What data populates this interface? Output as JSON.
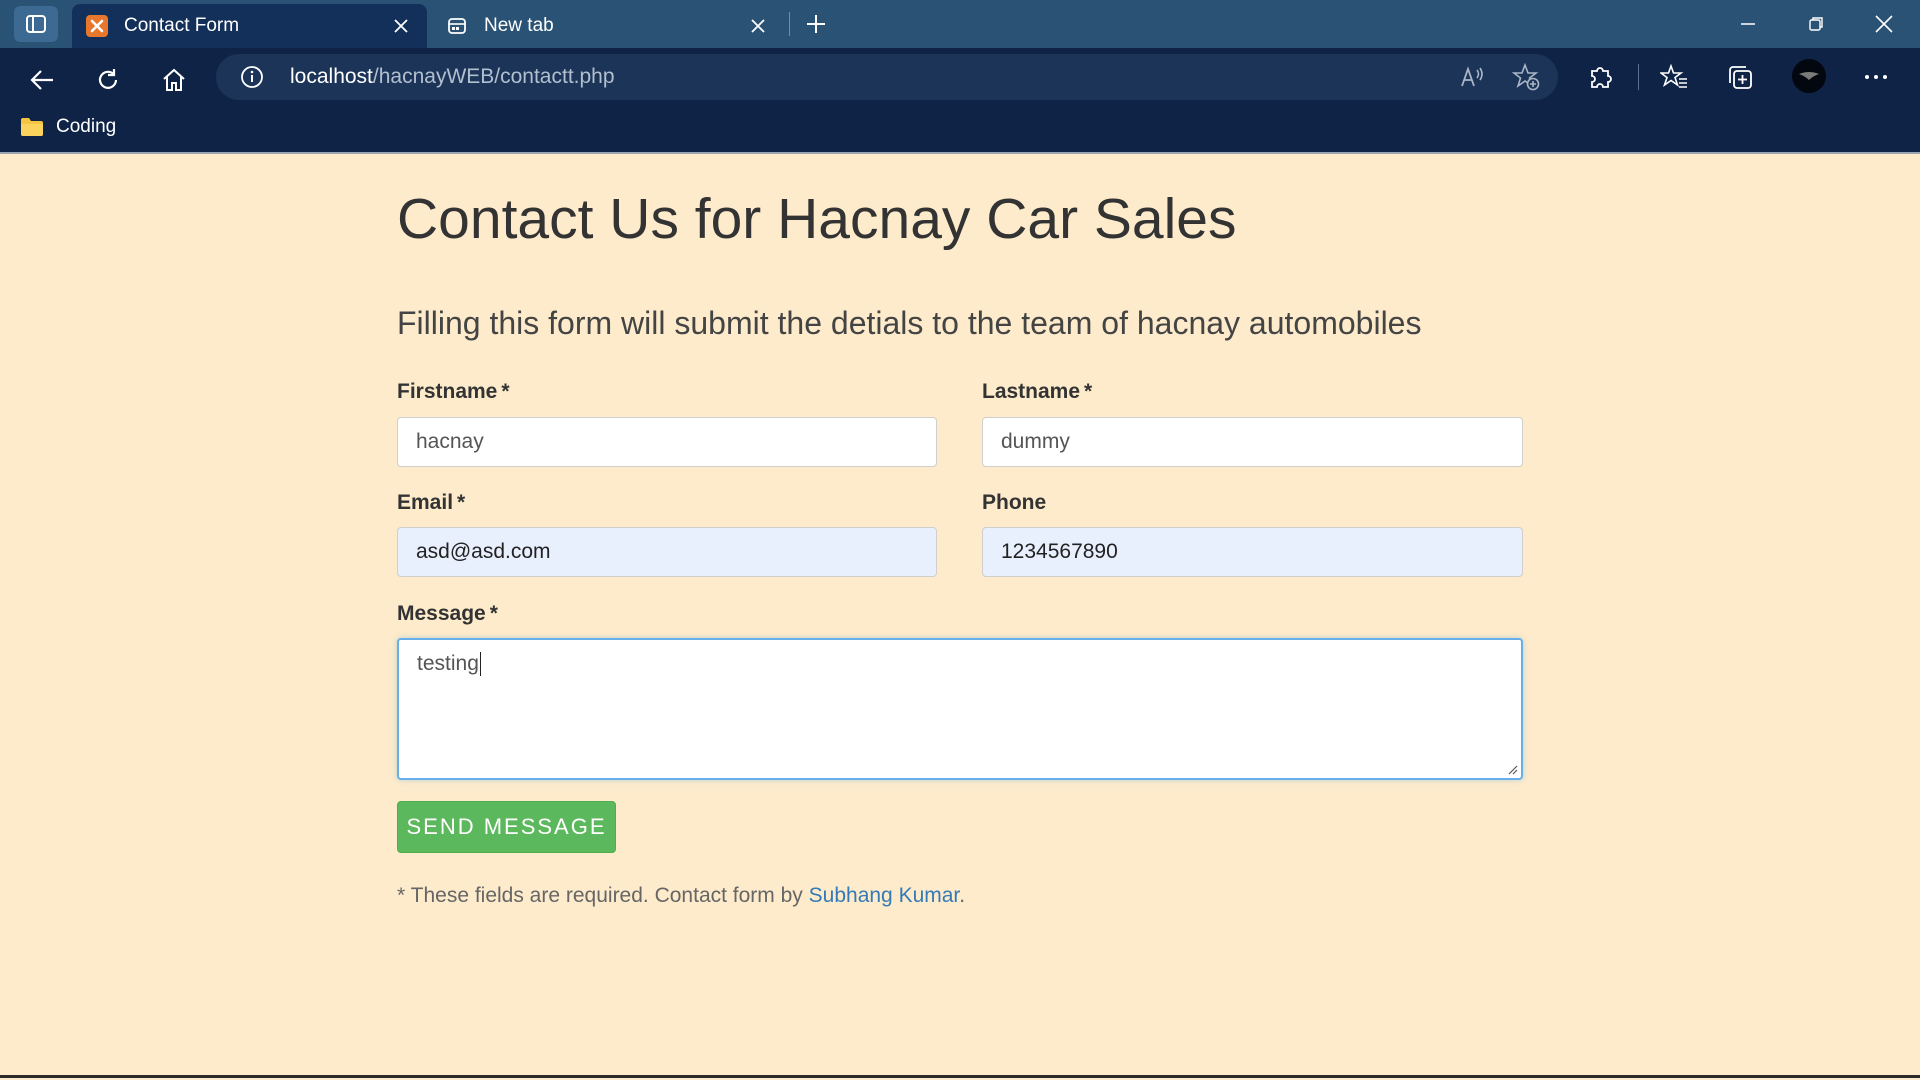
{
  "browser": {
    "tabs": [
      {
        "title": "Contact Form",
        "active": true,
        "icon": "xampp-icon"
      },
      {
        "title": "New tab",
        "active": false,
        "icon": "newtab-icon"
      }
    ],
    "address": {
      "host": "localhost",
      "path": "/hacnayWEB/contactt.php"
    },
    "bookmarks": [
      {
        "label": "Coding",
        "icon": "folder-icon"
      }
    ],
    "colors": {
      "tabbar": "#2a5275",
      "toolbar": "#0f2347",
      "active_tab": "#13305a"
    }
  },
  "page": {
    "title": "Contact Us for Hacnay Car Sales",
    "lead": "Filling this form will submit the detials to the team of hacnay automobiles",
    "fields": {
      "firstname": {
        "label": "Firstname",
        "required_mark": "*",
        "value": "hacnay"
      },
      "lastname": {
        "label": "Lastname",
        "required_mark": "*",
        "value": "dummy"
      },
      "email": {
        "label": "Email",
        "required_mark": "*",
        "value": "asd@asd.com"
      },
      "phone": {
        "label": "Phone",
        "value": "1234567890"
      },
      "message": {
        "label": "Message",
        "required_mark": "*",
        "value": "testing"
      }
    },
    "submit_label": "SEND MESSAGE",
    "footnote": {
      "prefix": "* These fields are required. Contact form by ",
      "link": "Subhang Kumar",
      "suffix": "."
    },
    "colors": {
      "background": "#fdebcb",
      "submit": "#5cb85c",
      "link": "#337ab7",
      "autofill": "#e8f0fe"
    }
  }
}
